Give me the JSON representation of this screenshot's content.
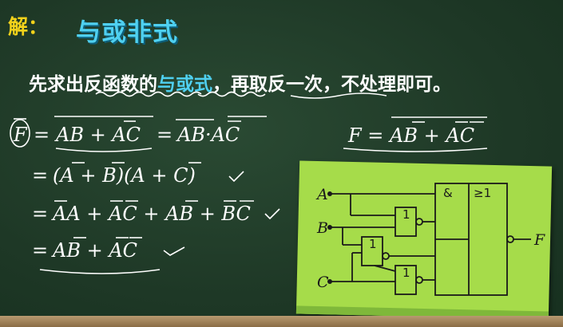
{
  "header": {
    "label": "解：",
    "title": "与或非式"
  },
  "sentence": {
    "part1": "先求出反函数的",
    "highlight": "与或式",
    "part2": "，再取反一次，不处理即可。"
  },
  "equations": {
    "line1": {
      "lhs": "F",
      "eq1": "AB + AC",
      "eq2": "AB·AC"
    },
    "line2": "(A + B)(A + C)",
    "line3": "AA + AC + AB + BC",
    "line4": "AB + AC",
    "result": "F = AB + AC"
  },
  "circuit": {
    "inputs": [
      "A",
      "B",
      "C"
    ],
    "output": "F",
    "not_gate_label": "1",
    "and_label": "&",
    "or_label": "≥1"
  },
  "colors": {
    "board": "#1f3a26",
    "highlight": "#4fd0f0",
    "heading": "#f2d21b",
    "note": "#a6dc4a"
  }
}
